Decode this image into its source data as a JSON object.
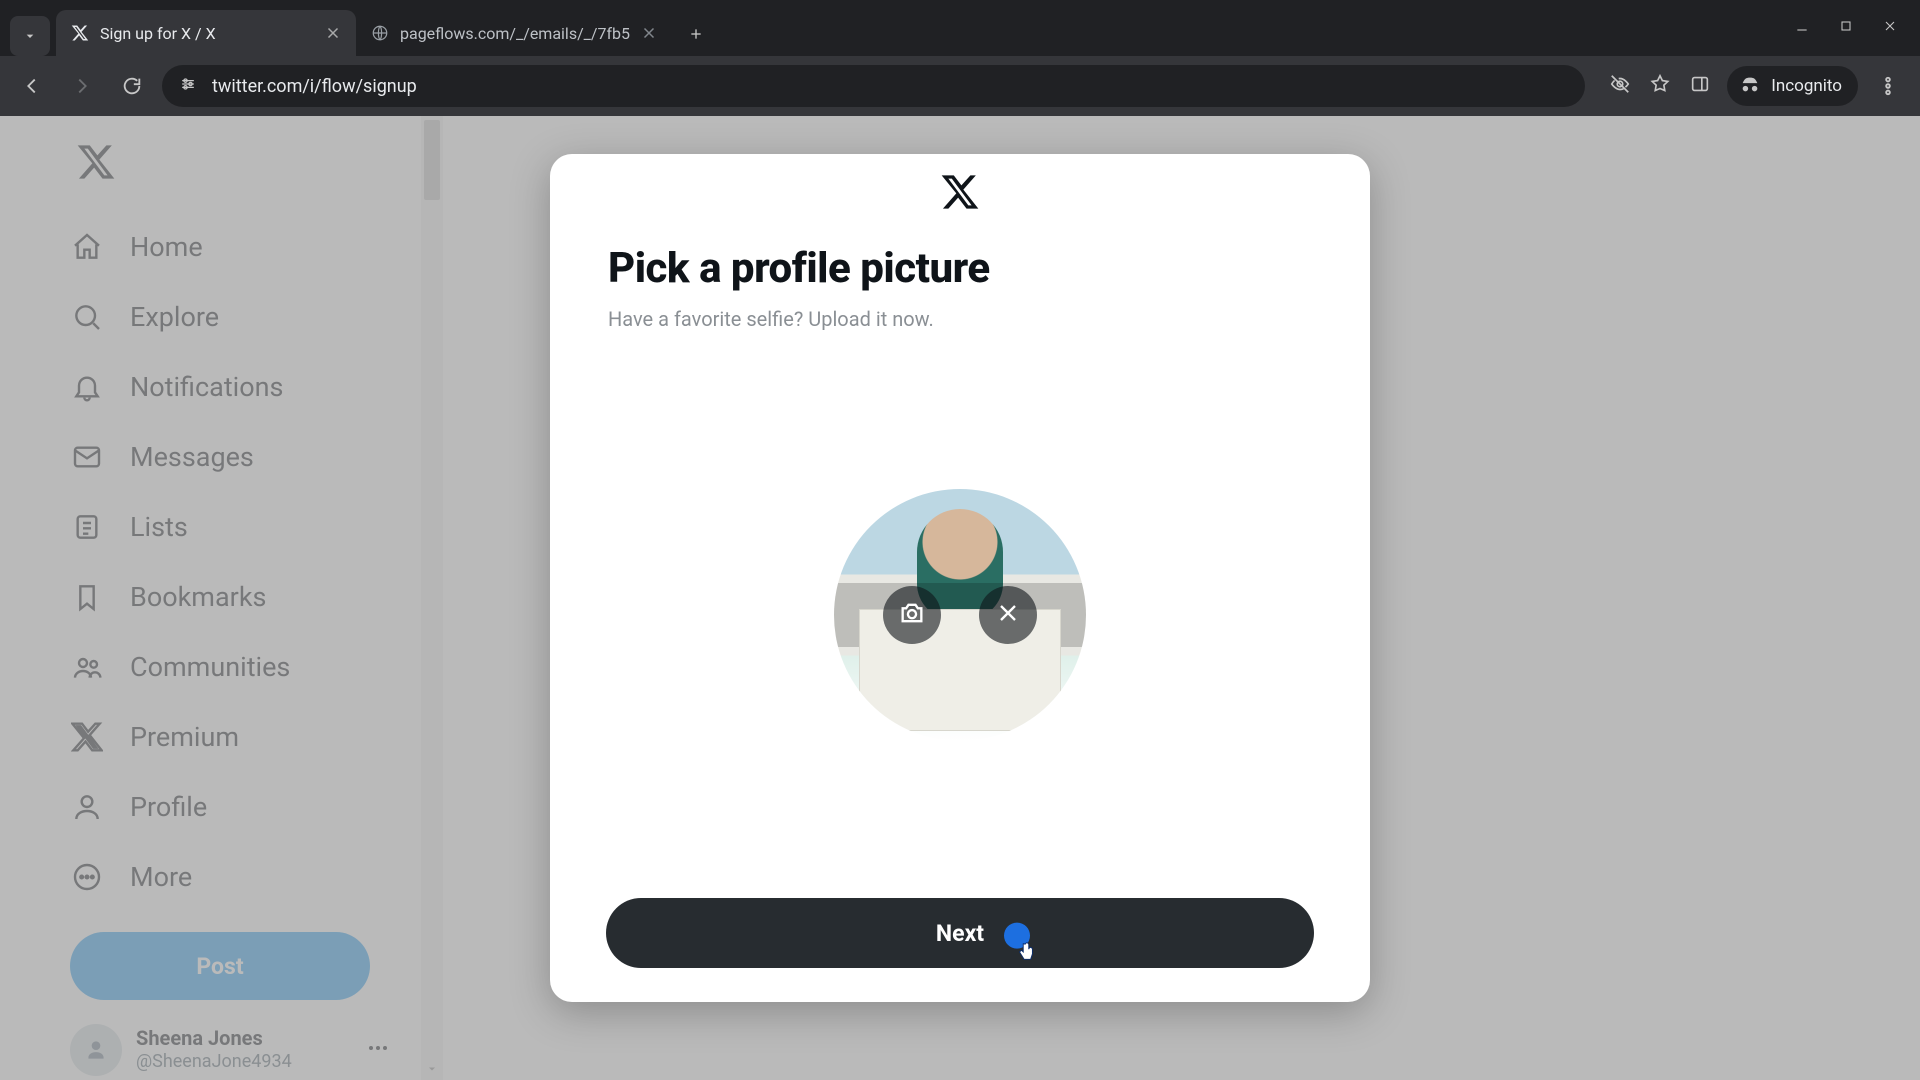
{
  "browser": {
    "tabs": [
      {
        "title": "Sign up for X / X"
      },
      {
        "title": "pageflows.com/_/emails/_/7fb5"
      }
    ],
    "url": "twitter.com/i/flow/signup",
    "incognito_label": "Incognito"
  },
  "sidebar": {
    "items": [
      {
        "label": "Home"
      },
      {
        "label": "Explore"
      },
      {
        "label": "Notifications"
      },
      {
        "label": "Messages"
      },
      {
        "label": "Lists"
      },
      {
        "label": "Bookmarks"
      },
      {
        "label": "Communities"
      },
      {
        "label": "Premium"
      },
      {
        "label": "Profile"
      },
      {
        "label": "More"
      }
    ],
    "post_label": "Post",
    "account": {
      "name": "Sheena Jones",
      "handle": "@SheenaJone4934"
    }
  },
  "modal": {
    "title": "Pick a profile picture",
    "subtitle": "Have a favorite selfie? Upload it now.",
    "next_label": "Next"
  }
}
